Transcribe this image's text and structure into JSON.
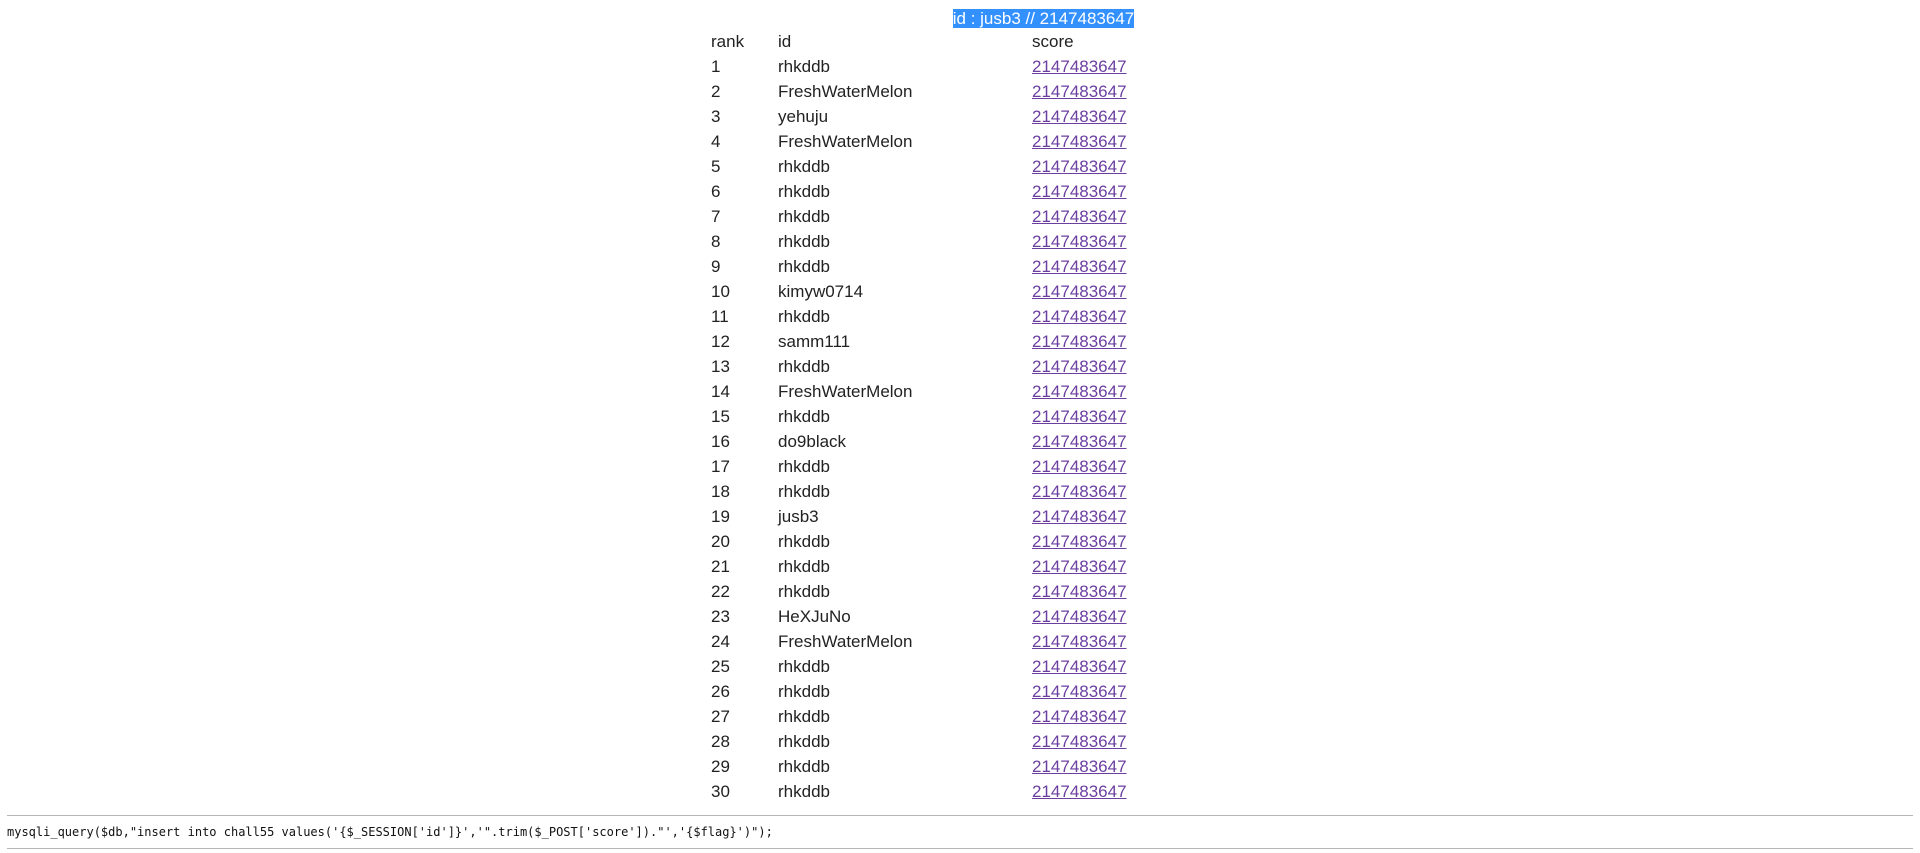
{
  "header": {
    "text": "id : jusb3 // 2147483647"
  },
  "table": {
    "headers": {
      "rank": "rank",
      "id": "id",
      "score": "score"
    },
    "rows": [
      {
        "rank": "1",
        "id": "rhkddb",
        "score": "2147483647"
      },
      {
        "rank": "2",
        "id": "FreshWaterMelon",
        "score": "2147483647"
      },
      {
        "rank": "3",
        "id": "yehuju",
        "score": "2147483647"
      },
      {
        "rank": "4",
        "id": "FreshWaterMelon",
        "score": "2147483647"
      },
      {
        "rank": "5",
        "id": "rhkddb",
        "score": "2147483647"
      },
      {
        "rank": "6",
        "id": "rhkddb",
        "score": "2147483647"
      },
      {
        "rank": "7",
        "id": "rhkddb",
        "score": "2147483647"
      },
      {
        "rank": "8",
        "id": "rhkddb",
        "score": "2147483647"
      },
      {
        "rank": "9",
        "id": "rhkddb",
        "score": "2147483647"
      },
      {
        "rank": "10",
        "id": "kimyw0714",
        "score": "2147483647"
      },
      {
        "rank": "11",
        "id": "rhkddb",
        "score": "2147483647"
      },
      {
        "rank": "12",
        "id": "samm111",
        "score": "2147483647"
      },
      {
        "rank": "13",
        "id": "rhkddb",
        "score": "2147483647"
      },
      {
        "rank": "14",
        "id": "FreshWaterMelon",
        "score": "2147483647"
      },
      {
        "rank": "15",
        "id": "rhkddb",
        "score": "2147483647"
      },
      {
        "rank": "16",
        "id": "do9black",
        "score": "2147483647"
      },
      {
        "rank": "17",
        "id": "rhkddb",
        "score": "2147483647"
      },
      {
        "rank": "18",
        "id": "rhkddb",
        "score": "2147483647"
      },
      {
        "rank": "19",
        "id": "jusb3",
        "score": "2147483647"
      },
      {
        "rank": "20",
        "id": "rhkddb",
        "score": "2147483647"
      },
      {
        "rank": "21",
        "id": "rhkddb",
        "score": "2147483647"
      },
      {
        "rank": "22",
        "id": "rhkddb",
        "score": "2147483647"
      },
      {
        "rank": "23",
        "id": "HeXJuNo",
        "score": "2147483647"
      },
      {
        "rank": "24",
        "id": "FreshWaterMelon",
        "score": "2147483647"
      },
      {
        "rank": "25",
        "id": "rhkddb",
        "score": "2147483647"
      },
      {
        "rank": "26",
        "id": "rhkddb",
        "score": "2147483647"
      },
      {
        "rank": "27",
        "id": "rhkddb",
        "score": "2147483647"
      },
      {
        "rank": "28",
        "id": "rhkddb",
        "score": "2147483647"
      },
      {
        "rank": "29",
        "id": "rhkddb",
        "score": "2147483647"
      },
      {
        "rank": "30",
        "id": "rhkddb",
        "score": "2147483647"
      }
    ]
  },
  "footer": {
    "code": "mysqli_query($db,\"insert into chall55 values('{$_SESSION['id']}','\".trim($_POST['score']).\"','{$flag}')\");"
  },
  "colors": {
    "selection_bg": "#3390ff",
    "selection_fg": "#ffffff",
    "link_visited": "#6b3fa0"
  }
}
